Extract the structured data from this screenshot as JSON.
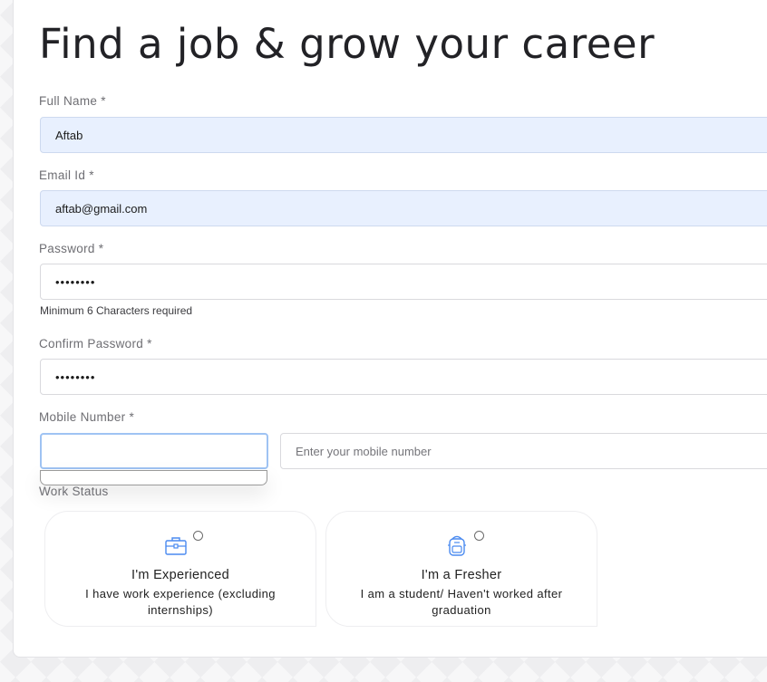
{
  "page": {
    "title": "Find a job & grow your career"
  },
  "form": {
    "full_name": {
      "label": "Full Name *",
      "value": "Aftab"
    },
    "email": {
      "label": "Email Id *",
      "value": "aftab@gmail.com"
    },
    "password": {
      "label": "Password *",
      "value": "••••••••",
      "hint": "Minimum 6 Characters required"
    },
    "confirm_password": {
      "label": "Confirm Password *",
      "value": "••••••••"
    },
    "mobile": {
      "label": "Mobile Number *",
      "country_code_value": "",
      "placeholder": "Enter your mobile number"
    },
    "work_status": {
      "label": "Work Status",
      "options": [
        {
          "title": "I'm Experienced",
          "description": "I have work experience (excluding internships)",
          "icon": "briefcase-icon",
          "selected": false
        },
        {
          "title": "I'm a Fresher",
          "description": "I am a student/ Haven't worked after graduation",
          "icon": "backpack-icon",
          "selected": false
        }
      ]
    }
  },
  "colors": {
    "autofill_bg": "#e8f0fe",
    "focus_border": "#9fc3f3",
    "icon_blue": "#4a8af0"
  }
}
